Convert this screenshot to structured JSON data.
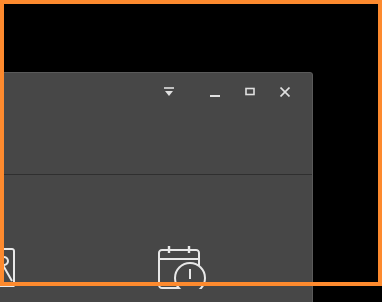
{
  "window": {
    "title": "",
    "controls": [
      {
        "name": "dropdown-icon",
        "action": "menu"
      },
      {
        "name": "minimize-icon",
        "action": "minimize"
      },
      {
        "name": "maximize-icon",
        "action": "maximize"
      },
      {
        "name": "close-icon",
        "action": "close"
      }
    ]
  },
  "content": {
    "tiles": [
      {
        "icon": "user-icon",
        "label": ""
      },
      {
        "icon": "calendar-clock-icon",
        "label": ""
      }
    ]
  },
  "colors": {
    "background": "#000000",
    "window": "#474747",
    "divider": "#2f2f2f",
    "icon": "#e8e8e8",
    "frame": "#fd8a2e"
  }
}
